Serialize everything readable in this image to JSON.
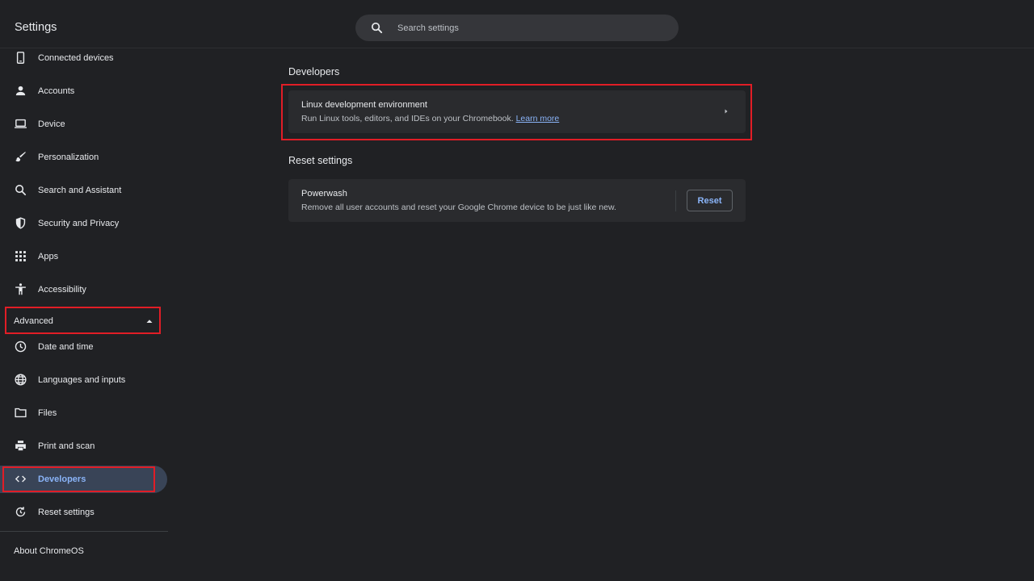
{
  "app": {
    "title": "Settings"
  },
  "search": {
    "placeholder": "Search settings"
  },
  "sidebar": {
    "items_top": [
      {
        "label": "Connected devices",
        "icon": "phone-icon"
      },
      {
        "label": "Accounts",
        "icon": "person-icon"
      },
      {
        "label": "Device",
        "icon": "laptop-icon"
      },
      {
        "label": "Personalization",
        "icon": "brush-icon"
      },
      {
        "label": "Search and Assistant",
        "icon": "search-icon"
      },
      {
        "label": "Security and Privacy",
        "icon": "shield-icon"
      },
      {
        "label": "Apps",
        "icon": "grid-icon"
      },
      {
        "label": "Accessibility",
        "icon": "accessibility-icon"
      }
    ],
    "advanced_label": "Advanced",
    "items_advanced": [
      {
        "label": "Date and time",
        "icon": "clock-icon"
      },
      {
        "label": "Languages and inputs",
        "icon": "globe-icon"
      },
      {
        "label": "Files",
        "icon": "folder-icon"
      },
      {
        "label": "Print and scan",
        "icon": "printer-icon"
      },
      {
        "label": "Developers",
        "icon": "code-icon",
        "selected": true
      },
      {
        "label": "Reset settings",
        "icon": "reset-icon"
      }
    ],
    "about_label": "About ChromeOS"
  },
  "main": {
    "developers": {
      "title": "Developers",
      "linux": {
        "title": "Linux development environment",
        "subtitle": "Run Linux tools, editors, and IDEs on your Chromebook.",
        "link": "Learn more"
      }
    },
    "reset": {
      "title": "Reset settings",
      "powerwash": {
        "title": "Powerwash",
        "subtitle": "Remove all user accounts and reset your Google Chrome device to be just like new.",
        "button": "Reset"
      }
    }
  },
  "colors": {
    "background": "#202124",
    "accent": "#8ab4f8",
    "selected_bg": "#394457",
    "highlight": "#e11d26"
  }
}
